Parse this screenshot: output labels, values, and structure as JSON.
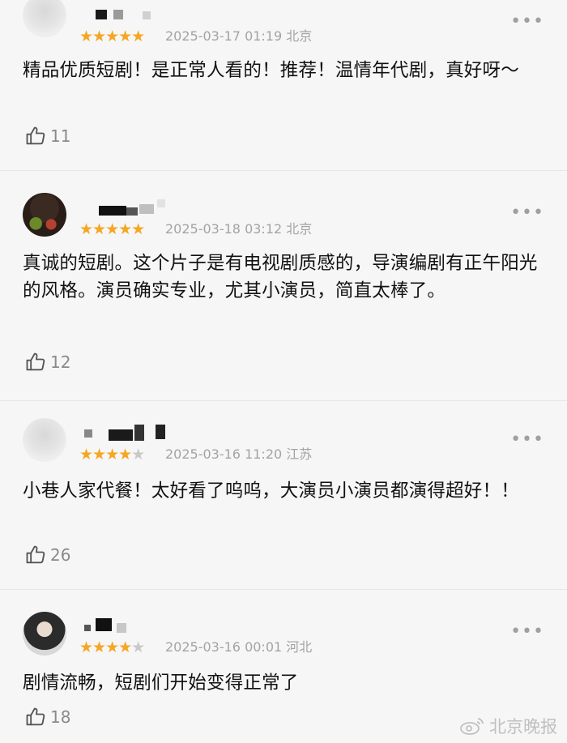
{
  "comments": [
    {
      "stars": "★★★★★",
      "stars_off": "",
      "meta": "2025-03-17 01:19 北京",
      "text": "精品优质短剧！是正常人看的！推荐！温情年代剧，真好呀～",
      "likes": "11"
    },
    {
      "stars": "★★★★★",
      "stars_off": "",
      "meta": "2025-03-18 03:12 北京",
      "text": "真诚的短剧。这个片子是有电视剧质感的，导演编剧有正午阳光的风格。演员确实专业，尤其小演员，简直太棒了。",
      "likes": "12"
    },
    {
      "stars": "★★★★",
      "stars_off": "★",
      "meta": "2025-03-16 11:20 江苏",
      "text": "小巷人家代餐！太好看了呜呜，大演员小演员都演得超好！！",
      "likes": "26"
    },
    {
      "stars": "★★★★",
      "stars_off": "★",
      "meta": "2025-03-16 00:01 河北",
      "text": "剧情流畅，短剧们开始变得正常了",
      "likes": "18"
    }
  ],
  "more_label": "•••",
  "watermark": {
    "text": "北京晚报",
    "icon": "weibo-icon"
  },
  "colors": {
    "star_on": "#f5a623",
    "star_off": "#c9c9c9",
    "meta": "#a3a3a3",
    "background": "#f6f6f6"
  }
}
